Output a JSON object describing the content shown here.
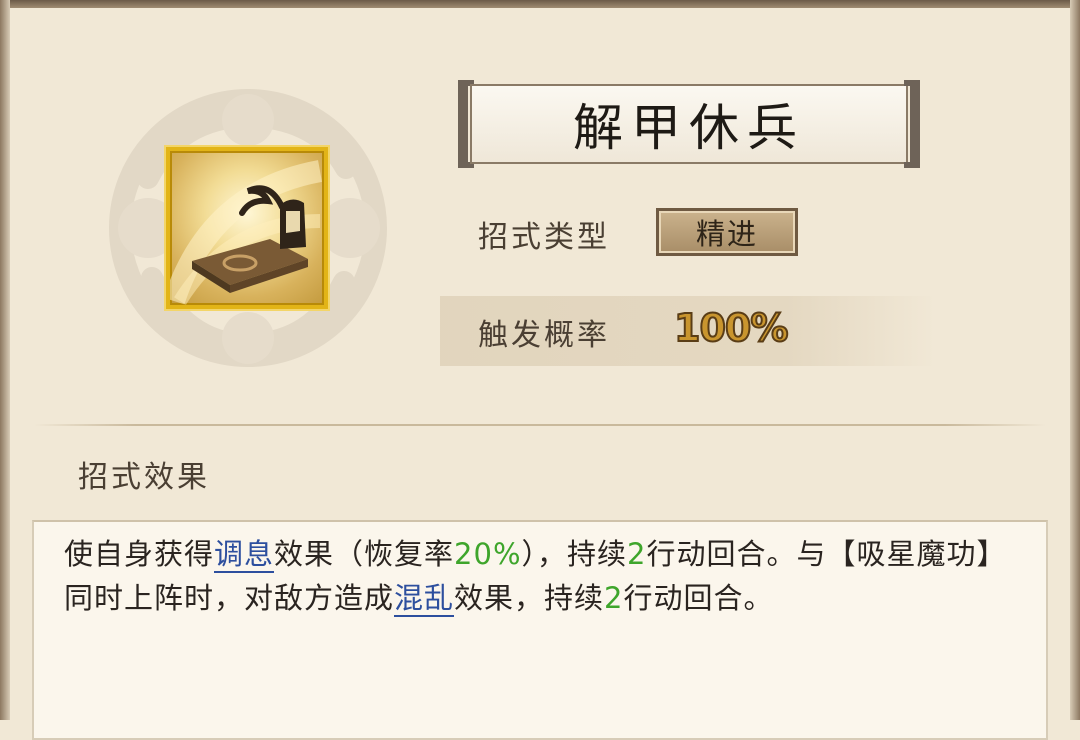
{
  "skill": {
    "name": "解甲休兵",
    "type_label": "招式类型",
    "type_value": "精进",
    "rate_label": "触发概率",
    "rate_value": "100%",
    "icon": "helmet-on-scroll-icon"
  },
  "effect": {
    "title": "招式效果",
    "segments": [
      {
        "text": "使自身获得",
        "style": "plain"
      },
      {
        "text": "调息",
        "style": "keyword"
      },
      {
        "text": "效果（恢复率",
        "style": "plain"
      },
      {
        "text": "20%",
        "style": "number"
      },
      {
        "text": "），持续",
        "style": "plain"
      },
      {
        "text": "2",
        "style": "number"
      },
      {
        "text": "行动回合。与【吸星魔功】同时上阵时，对敌方造成",
        "style": "plain"
      },
      {
        "text": "混乱",
        "style": "keyword"
      },
      {
        "text": "效果，持续",
        "style": "plain"
      },
      {
        "text": "2",
        "style": "number"
      },
      {
        "text": "行动回合。",
        "style": "plain"
      }
    ]
  },
  "colors": {
    "background": "#f1e8d6",
    "keyword": "#2d4f9e",
    "number": "#3ea52b",
    "rate": "#c9952e",
    "icon_border": "#e2b417"
  }
}
